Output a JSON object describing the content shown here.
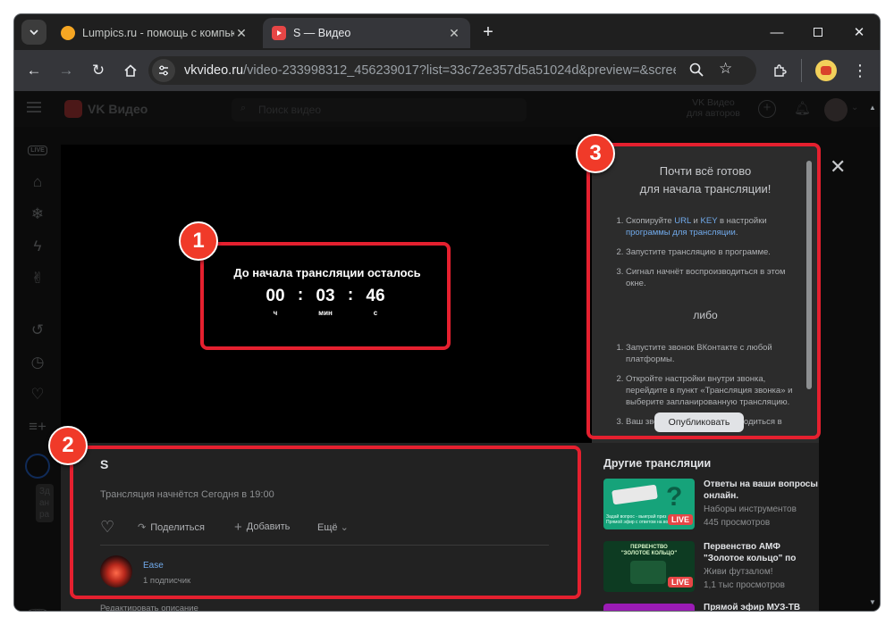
{
  "browser": {
    "tabs": [
      {
        "title": "Lumpics.ru - помощь с компью",
        "favicon_color": "#f5a623"
      },
      {
        "title": "S — Видео",
        "favicon_color": "#e64646"
      }
    ],
    "url_host": "vkvideo.ru",
    "url_path": "/video-233998312_456239017?list=33c72e357d5a51024d&preview=&screen..."
  },
  "site": {
    "logo_text": "VK Видео",
    "search_placeholder": "Поиск видео",
    "authors_line1": "VK Видео",
    "authors_line2": "для авторов"
  },
  "leftnav": {
    "live_label": "LIVE",
    "partial_texts": [
      "Зд",
      "ан",
      "ра"
    ]
  },
  "player": {
    "countdown_title": "До начала трансляции осталось",
    "hours": "00",
    "minutes": "03",
    "seconds": "46",
    "unit_h": "ч",
    "unit_m": "мин",
    "unit_s": "с",
    "separator": ":"
  },
  "video": {
    "title": "S",
    "starts": "Трансляция начнётся Сегодня в 19:00",
    "share": "Поделиться",
    "add": "Добавить",
    "more": "Ещё",
    "channel_name": "Ease",
    "subscribers": "1 подписчик",
    "edit_description": "Редактировать описание"
  },
  "panel": {
    "heading_line1": "Почти всё готово",
    "heading_line2": "для начала трансляции!",
    "step1_a": "Скопируйте ",
    "step1_url": "URL",
    "step1_and": " и ",
    "step1_key": "KEY",
    "step1_b": " в настройки",
    "step1_link": "программы для трансляции",
    "step1_end": ".",
    "step2": "Запустите трансляцию в программе.",
    "step3": "Сигнал начнёт воспроизводиться в этом окне.",
    "or": "либо",
    "alt1": "Запустите звонок ВКонтакте с любой платформы.",
    "alt2": "Откройте настройки внутри звонка, перейдите в пункт «Трансляция звонка» и выберите запланированную трансляцию.",
    "alt3": "Ваш звонок начнёт воспроизводиться в",
    "publish": "Опубликовать"
  },
  "others": {
    "heading": "Другие трансляции",
    "items": [
      {
        "title": "Ответы на ваши вопросы онлайн.",
        "channel": "Наборы инструментов",
        "views": "445 просмотров",
        "thumb_caption": "Задай вопрос - выиграй приз\nПрямой эфир с ответом на вопрос",
        "live": "LIVE"
      },
      {
        "title": "Первенство АМФ \"Золотое кольцо\" по",
        "channel": "Живи футзалом!",
        "views": "1,1 тыс просмотров",
        "thumb_caption": "ПЕРВЕНСТВО\n\"ЗОЛОТОЕ КОЛЬЦО\"",
        "live": "LIVE"
      },
      {
        "title": "Прямой эфир МУЗ-ТВ",
        "channel": "",
        "views": "",
        "thumb_caption": "",
        "live": ""
      }
    ]
  },
  "annotations": {
    "badge1": "1",
    "badge2": "2",
    "badge3": "3",
    "highlight_color": "#e5202f"
  }
}
